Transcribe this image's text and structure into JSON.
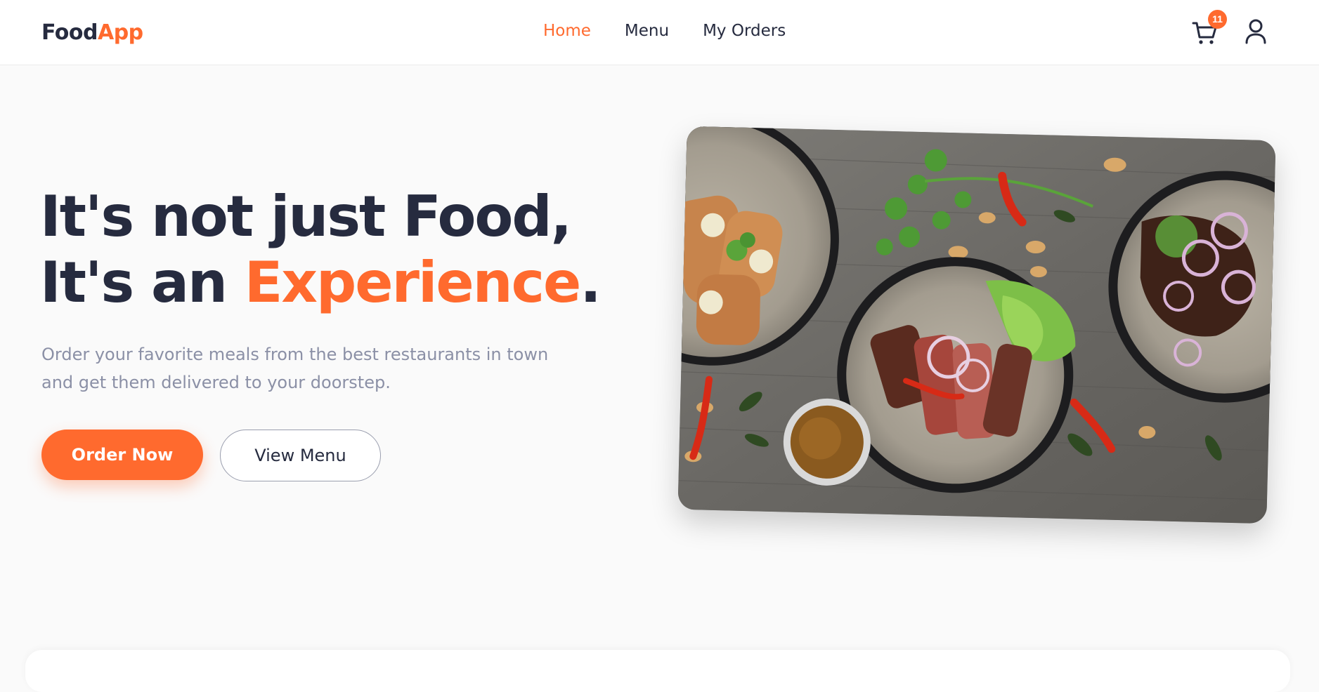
{
  "brand": {
    "part1": "Food",
    "part2": "App"
  },
  "nav": {
    "items": [
      {
        "label": "Home",
        "active": true
      },
      {
        "label": "Menu",
        "active": false
      },
      {
        "label": "My Orders",
        "active": false
      }
    ]
  },
  "cart": {
    "count": "11",
    "icon": "shopping-cart-icon"
  },
  "user": {
    "icon": "user-icon"
  },
  "hero": {
    "line1": "It's not just Food,",
    "line2_prefix": "It's an ",
    "line2_accent": "Experience",
    "line2_suffix": ".",
    "subtitle": "Order your favorite meals from the best restaurants in town and get them delivered to your doorstep.",
    "primary_cta": "Order Now",
    "secondary_cta": "View Menu"
  },
  "colors": {
    "accent": "#ff6a2e",
    "text": "#262b3f",
    "muted": "#8b90a6",
    "background": "#fafafa"
  }
}
